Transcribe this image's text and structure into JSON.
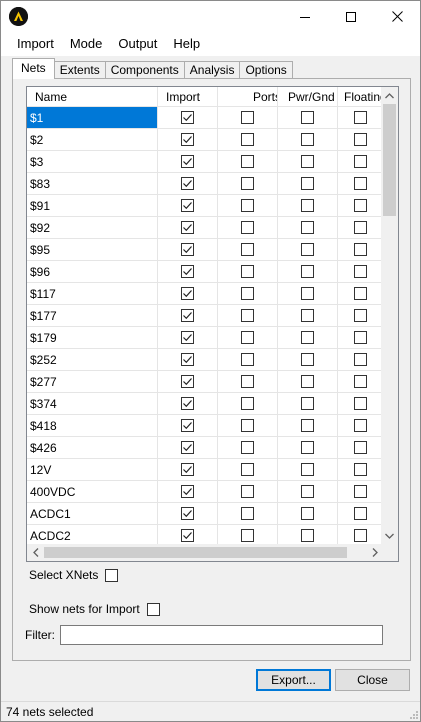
{
  "menu": {
    "items": [
      "Import",
      "Mode",
      "Output",
      "Help"
    ]
  },
  "tabs": [
    "Nets",
    "Extents",
    "Components",
    "Analysis",
    "Options"
  ],
  "grid": {
    "columns": [
      "Name",
      "Import",
      "Ports",
      "Pwr/Gnd",
      "Floating"
    ],
    "rows": [
      {
        "name": "$1",
        "import": true,
        "ports": false,
        "pwr_gnd": false,
        "floating": false,
        "selected": true
      },
      {
        "name": "$2",
        "import": true,
        "ports": false,
        "pwr_gnd": false,
        "floating": false
      },
      {
        "name": "$3",
        "import": true,
        "ports": false,
        "pwr_gnd": false,
        "floating": false
      },
      {
        "name": "$83",
        "import": true,
        "ports": false,
        "pwr_gnd": false,
        "floating": false
      },
      {
        "name": "$91",
        "import": true,
        "ports": false,
        "pwr_gnd": false,
        "floating": false
      },
      {
        "name": "$92",
        "import": true,
        "ports": false,
        "pwr_gnd": false,
        "floating": false
      },
      {
        "name": "$95",
        "import": true,
        "ports": false,
        "pwr_gnd": false,
        "floating": false
      },
      {
        "name": "$96",
        "import": true,
        "ports": false,
        "pwr_gnd": false,
        "floating": false
      },
      {
        "name": "$117",
        "import": true,
        "ports": false,
        "pwr_gnd": false,
        "floating": false
      },
      {
        "name": "$177",
        "import": true,
        "ports": false,
        "pwr_gnd": false,
        "floating": false
      },
      {
        "name": "$179",
        "import": true,
        "ports": false,
        "pwr_gnd": false,
        "floating": false
      },
      {
        "name": "$252",
        "import": true,
        "ports": false,
        "pwr_gnd": false,
        "floating": false
      },
      {
        "name": "$277",
        "import": true,
        "ports": false,
        "pwr_gnd": false,
        "floating": false
      },
      {
        "name": "$374",
        "import": true,
        "ports": false,
        "pwr_gnd": false,
        "floating": false
      },
      {
        "name": "$418",
        "import": true,
        "ports": false,
        "pwr_gnd": false,
        "floating": false
      },
      {
        "name": "$426",
        "import": true,
        "ports": false,
        "pwr_gnd": false,
        "floating": false
      },
      {
        "name": "12V",
        "import": true,
        "ports": false,
        "pwr_gnd": false,
        "floating": false
      },
      {
        "name": "400VDC",
        "import": true,
        "ports": false,
        "pwr_gnd": false,
        "floating": false
      },
      {
        "name": "ACDC1",
        "import": true,
        "ports": false,
        "pwr_gnd": false,
        "floating": false
      },
      {
        "name": "ACDC2",
        "import": true,
        "ports": false,
        "pwr_gnd": false,
        "floating": false
      }
    ]
  },
  "options": {
    "select_xnets_label": "Select XNets",
    "select_xnets_checked": false,
    "show_nets_label": "Show nets for Import",
    "show_nets_checked": false,
    "filter_label": "Filter:",
    "filter_value": ""
  },
  "buttons": {
    "export_label": "Export...",
    "close_label": "Close"
  },
  "status": {
    "text": "74 nets selected"
  },
  "colors": {
    "accent": "#0078d7",
    "logo_yellow": "#f5c400"
  }
}
